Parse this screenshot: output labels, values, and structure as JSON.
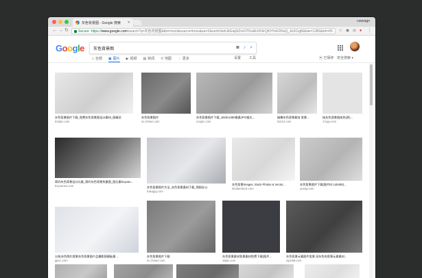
{
  "browser": {
    "tab_title": "灰色背景图 - Google 搜索",
    "user_name": "cowragn",
    "secure_label": "Secure",
    "url_scheme": "https://",
    "url_host": "www.google.com",
    "url_rest": "/search?q=灰色背景图&tbm=isch&source=lnms&sa=X&ved=0ahUKEwj0iZmO7fXaAhVK6rQKHYvKD5wQ_AUICigB&biw=1280&bih=653"
  },
  "search": {
    "query": "灰色背景图",
    "tabs": [
      {
        "label": "全部",
        "icon": "search-icon",
        "glyph": "⌕"
      },
      {
        "label": "图片",
        "icon": "image-icon",
        "glyph": "▣"
      },
      {
        "label": "视频",
        "icon": "video-icon",
        "glyph": "▶"
      },
      {
        "label": "新闻",
        "icon": "news-icon",
        "glyph": "▤"
      },
      {
        "label": "地图",
        "icon": "map-icon",
        "glyph": "⚲"
      },
      {
        "label": "更多",
        "icon": "more-icon",
        "glyph": "⋮"
      }
    ],
    "active_tab": "图片",
    "settings_label": "设置",
    "tools_label": "工具",
    "collections_label": "▣ 已保存",
    "safesearch_label": "安全搜索 ▾"
  },
  "results": [
    {
      "caption": "灰色背景图片下载_免费灰色背景图设计素材_图精灵",
      "source": "616pic.com",
      "colors": [
        "#e8e8e8",
        "#cfcfcf",
        "#f2f2f2"
      ]
    },
    {
      "caption": "灰色背景图片",
      "source": "sc.chinaz.com",
      "colors": [
        "#6a6a6a",
        "#8a8a8a",
        "#555555"
      ]
    },
    {
      "caption": "灰色背景图片下载_1920x1080像素JPG格式...",
      "source": "ooopic.com",
      "colors": [
        "#b8b8b8",
        "#9a9a9a",
        "#d2d2d2"
      ]
    },
    {
      "caption": "磁暴灰色背景素材 背景...",
      "source": "52112.com",
      "colors": [
        "#d6d6d6",
        "#bdbdbd",
        "#e6e6e6"
      ]
    },
    {
      "caption": "纯灰色背景图纯色(原)...",
      "source": "17ypy.com",
      "colors": [
        "#e4e4e4",
        "#e4e4e4",
        "#e4e4e4"
      ]
    },
    {
      "caption": "简约灰色背景设计元素_简约灰色背景矢量图_图元素51yuan...",
      "source": "51yuansu.com",
      "colors": [
        "#2a2a2a",
        "#777777",
        "#d4d4d4"
      ]
    },
    {
      "caption": "灰色背景图片大全_灰色背景素材下载_简报办公",
      "source": "hakujpg.com",
      "colors": [
        "#c7c9cd",
        "#e6e7ea",
        "#a9acb2"
      ]
    },
    {
      "caption": "灰色背景Images, Stock Photos & Vector...",
      "source": "shutterstock.com",
      "colors": [
        "#e9e9e9",
        "#d8d8d8",
        "#f5f5f5"
      ]
    },
    {
      "caption": "灰色背景图片下载(图片ID:148408)...",
      "source": "yuang.com",
      "colors": [
        "#cbcbcb",
        "#b4b4b4",
        "#dedede"
      ]
    },
    {
      "caption": "12张灰色简约背景灰色背景图产品摄影图模板素...",
      "source": "gjsvc.com",
      "colors": [
        "#dfe2e8",
        "#f3f4f6",
        "#cfd3dc"
      ]
    },
    {
      "caption": "灰色背景图片下载",
      "source": "sc.chinaz.com",
      "colors": [
        "#7a7a7a",
        "#9b9b9b",
        "#666666"
      ]
    },
    {
      "caption": "灰色背景素材背景素材免费下载(图片...",
      "source": "16pic.com",
      "colors": [
        "#3c3d42",
        "#3c3d42",
        "#3c3d42"
      ]
    },
    {
      "caption": "灰色背景元素图片背景 深灰色的背景元素素材...",
      "source": "nipic69.com",
      "colors": [
        "#5a5a5a",
        "#3f3f3f",
        "#777777"
      ]
    },
    {
      "caption": "",
      "source": "",
      "colors": [
        "#b0b0b0",
        "#c8c8c8",
        "#999999"
      ]
    },
    {
      "caption": "",
      "source": "",
      "colors": [
        "#a3a3a3",
        "#8c8c8c",
        "#bcbcbc"
      ]
    },
    {
      "caption": "",
      "source": "",
      "colors": [
        "#7e7e7e",
        "#6a6a6a",
        "#999999"
      ]
    },
    {
      "caption": "",
      "source": "",
      "colors": [
        "#d8d8d8",
        "#c4c4c4",
        "#e8e8e8"
      ]
    },
    {
      "caption": "",
      "source": "",
      "colors": [
        "#ececec",
        "#dedede",
        "#f6f6f6"
      ]
    }
  ]
}
